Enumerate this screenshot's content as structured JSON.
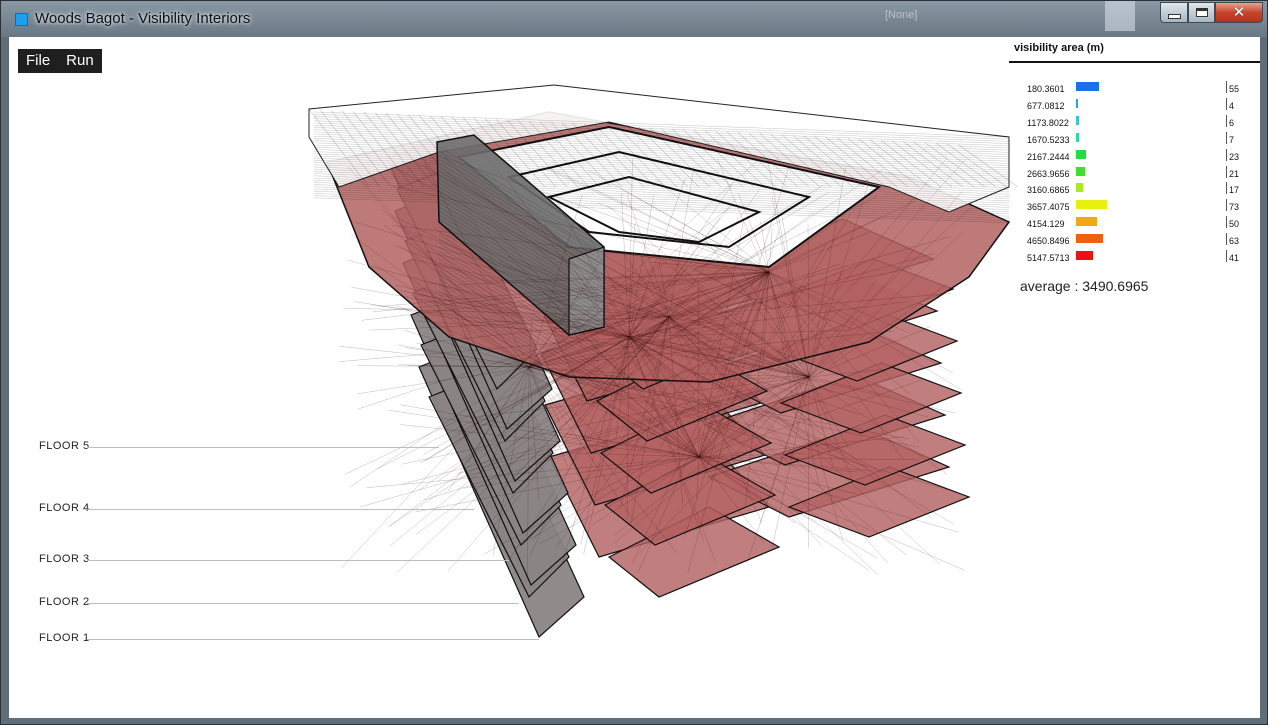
{
  "window": {
    "title": "Woods Bagot - Visibility Interiors",
    "ghost_title": "[None]",
    "controls": {
      "minimize": "minimize",
      "maximize": "maximize",
      "close": "✕"
    }
  },
  "menu": {
    "items": [
      "File",
      "Run"
    ]
  },
  "legend": {
    "title": "visibility area (m)",
    "rows": [
      {
        "label": "180.3601",
        "count": "55",
        "color": "#1e6ff0",
        "value": 55
      },
      {
        "label": "677.0812",
        "count": "4",
        "color": "#2aa6e8",
        "value": 4
      },
      {
        "label": "1173.8022",
        "count": "6",
        "color": "#33c4d8",
        "value": 6
      },
      {
        "label": "1670.5233",
        "count": "7",
        "color": "#2fd6a8",
        "value": 7
      },
      {
        "label": "2167.2444",
        "count": "23",
        "color": "#22dd44",
        "value": 23
      },
      {
        "label": "2663.9656",
        "count": "21",
        "color": "#3ee02a",
        "value": 21
      },
      {
        "label": "3160.6865",
        "count": "17",
        "color": "#a6ec1c",
        "value": 17
      },
      {
        "label": "3657.4075",
        "count": "73",
        "color": "#e8f010",
        "value": 73
      },
      {
        "label": "4154.129",
        "count": "50",
        "color": "#f0a818",
        "value": 50
      },
      {
        "label": "4650.8496",
        "count": "63",
        "color": "#f06010",
        "value": 63
      },
      {
        "label": "5147.5713",
        "count": "41",
        "color": "#f01010",
        "value": 41
      }
    ],
    "average": "average : 3490.6965"
  },
  "floors": [
    "FLOOR 5",
    "FLOOR 4",
    "FLOOR 3",
    "FLOOR 2",
    "FLOOR 1"
  ],
  "colors": {
    "floor_red": "#b36262",
    "core_grey": "#8a8484",
    "edge": "#111111"
  }
}
